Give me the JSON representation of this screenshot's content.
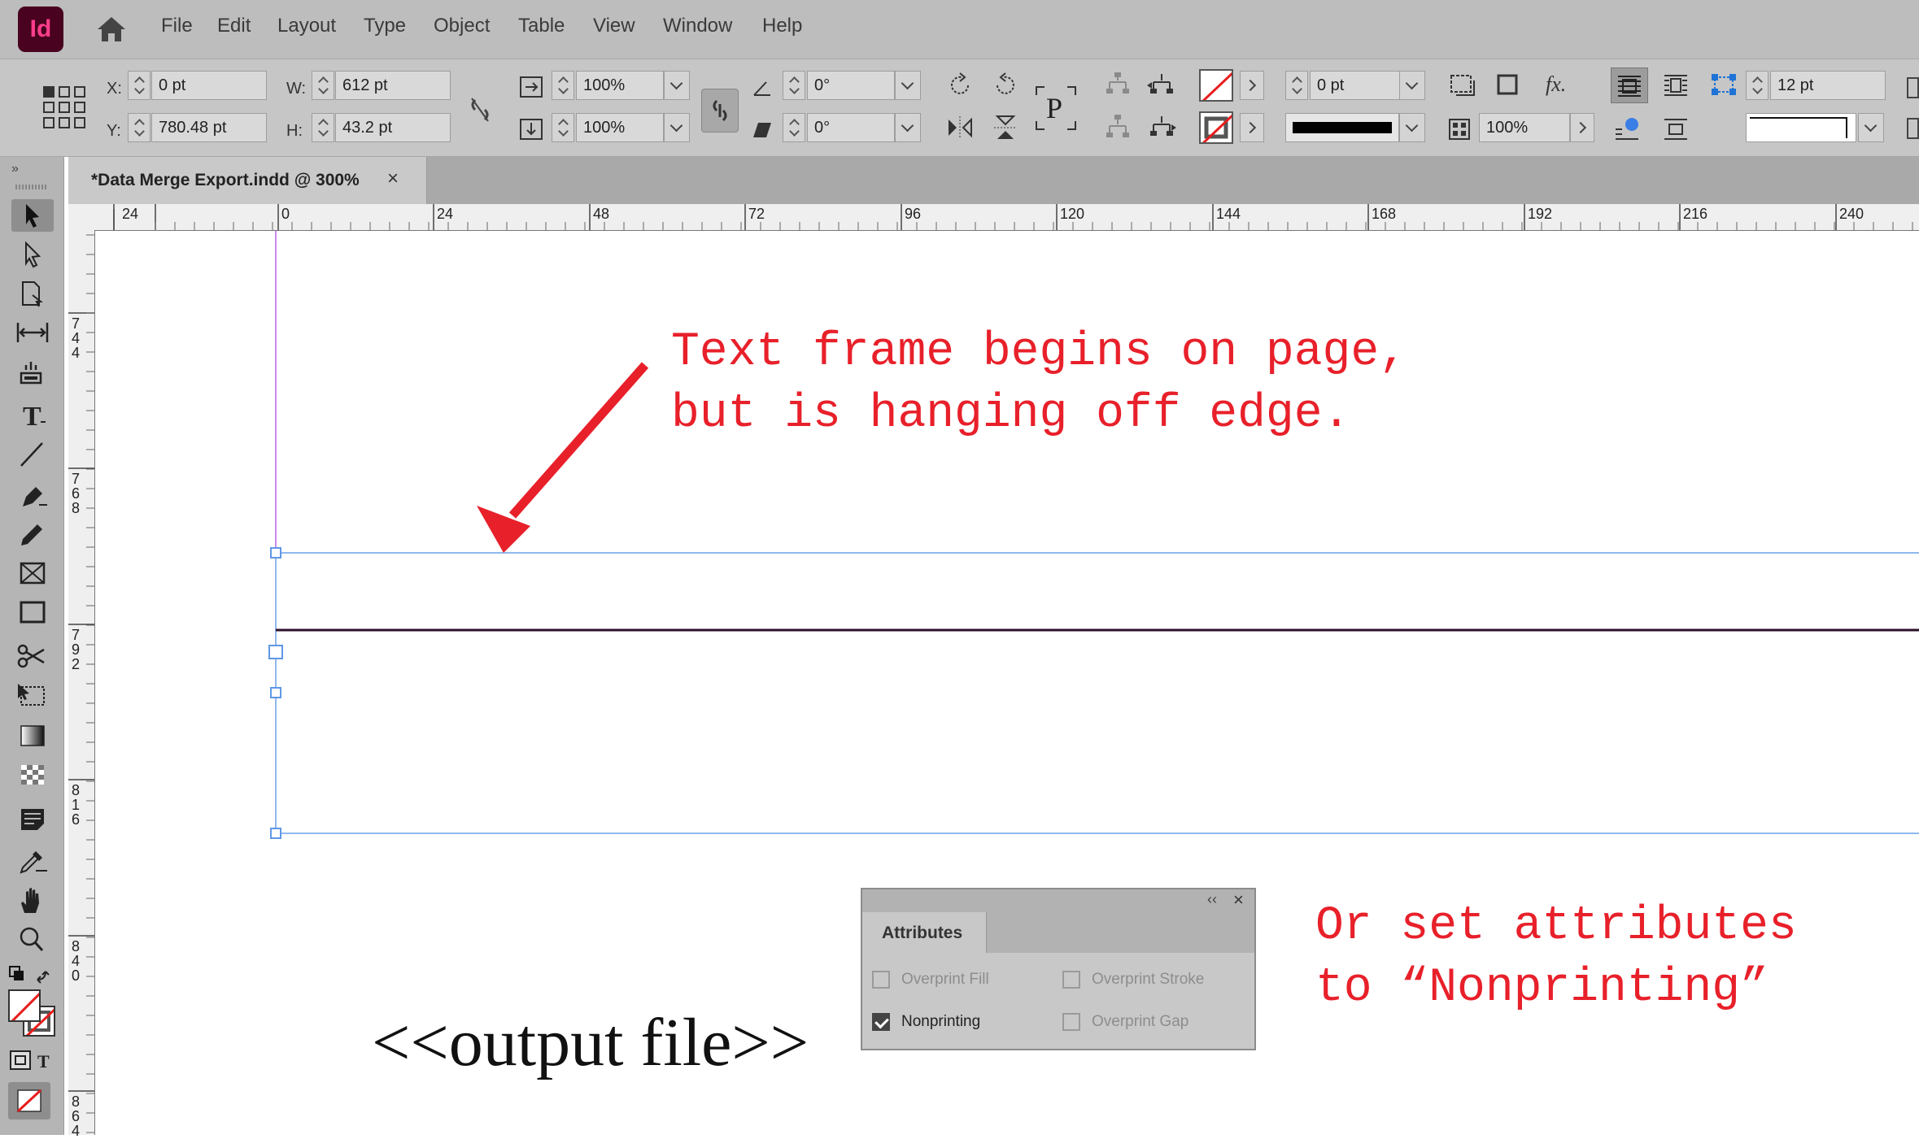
{
  "app": {
    "logo_text": "Id"
  },
  "menu": [
    "File",
    "Edit",
    "Layout",
    "Type",
    "Object",
    "Table",
    "View",
    "Window",
    "Help"
  ],
  "control": {
    "x_label": "X:",
    "x_value": "0 pt",
    "y_label": "Y:",
    "y_value": "780.48 pt",
    "w_label": "W:",
    "w_value": "612 pt",
    "h_label": "H:",
    "h_value": "43.2 pt",
    "scale_x": "100%",
    "scale_y": "100%",
    "rotation": "0°",
    "shear": "0°",
    "stroke_weight": "0 pt",
    "opacity": "100%",
    "spacing": "12 pt",
    "paragraph_glyph": "P",
    "fx_label": "fx."
  },
  "tab": {
    "label": "*Data Merge Export.indd @ 300%",
    "close": "×"
  },
  "hruler": [
    "24",
    "0",
    "24",
    "48",
    "72",
    "96",
    "120",
    "144",
    "168",
    "192",
    "216",
    "240"
  ],
  "vruler": [
    "744",
    "768",
    "792",
    "816",
    "840",
    "864"
  ],
  "canvas": {
    "placeholder": "<<output file>>",
    "annotation_1": "Text frame begins on page,\nbut is hanging off edge.",
    "annotation_2": "Or set attributes\nto “Nonprinting”"
  },
  "attributes_panel": {
    "collapse": "‹‹",
    "close": "×",
    "tab": "Attributes",
    "options": [
      {
        "label": "Overprint Fill",
        "checked": false
      },
      {
        "label": "Overprint Stroke",
        "checked": false
      },
      {
        "label": "Nonprinting",
        "checked": true
      },
      {
        "label": "Overprint Gap",
        "checked": false
      }
    ]
  },
  "colors": {
    "annotation": "#e8202a",
    "frame_edge": "#8fb8ee",
    "accent": "#49021f"
  }
}
